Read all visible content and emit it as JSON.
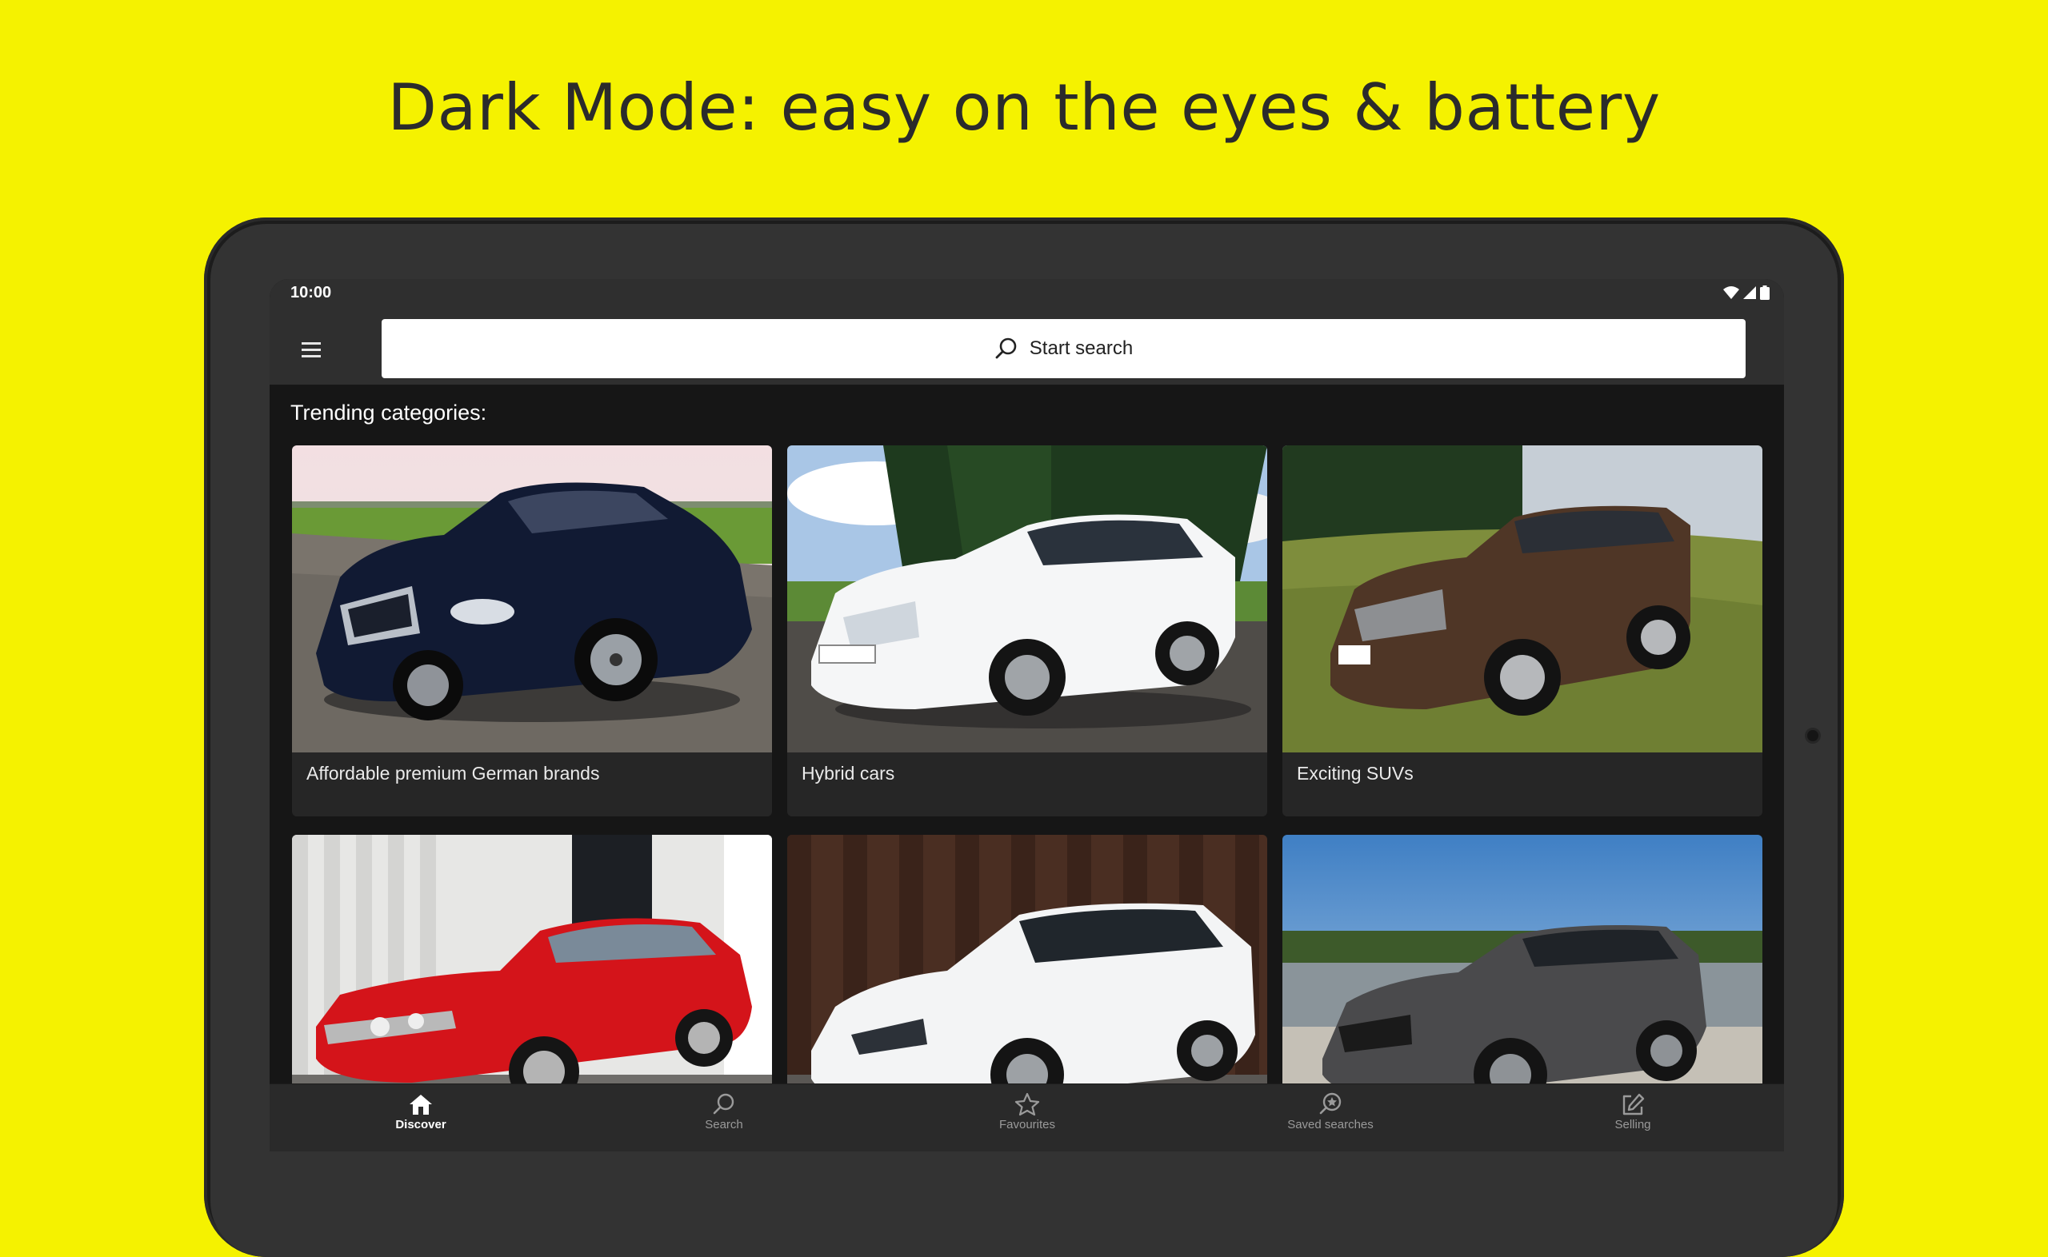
{
  "headline": "Dark Mode: easy on the eyes & battery",
  "status": {
    "time": "10:00",
    "icons": [
      "wifi-icon",
      "signal-icon",
      "battery-icon"
    ]
  },
  "appbar": {
    "menu_icon": "hamburger-menu-icon",
    "search_placeholder": "Start search",
    "search_icon": "search-icon"
  },
  "section_title": "Trending categories:",
  "categories": [
    {
      "label": "Affordable premium German brands",
      "image": "dark-blue-sedan-photo"
    },
    {
      "label": "Hybrid cars",
      "image": "white-hybrid-hatchback-photo"
    },
    {
      "label": "Exciting SUVs",
      "image": "brown-suv-photo"
    },
    {
      "label": "",
      "image": "red-classic-coupe-photo"
    },
    {
      "label": "",
      "image": "white-compact-wagon-photo"
    },
    {
      "label": "",
      "image": "grey-hatchback-photo"
    }
  ],
  "bottom_nav": [
    {
      "label": "Discover",
      "icon": "home-icon",
      "active": true
    },
    {
      "label": "Search",
      "icon": "search-icon",
      "active": false
    },
    {
      "label": "Favourites",
      "icon": "star-icon",
      "active": false
    },
    {
      "label": "Saved searches",
      "icon": "saved-search-icon",
      "active": false
    },
    {
      "label": "Selling",
      "icon": "edit-icon",
      "active": false
    }
  ],
  "colors": {
    "background": "#f5f200",
    "headline": "#2b2b2b",
    "bezel": "#333333",
    "screen": "#161616",
    "card": "#262626",
    "appbar": "#2f2f2f"
  }
}
